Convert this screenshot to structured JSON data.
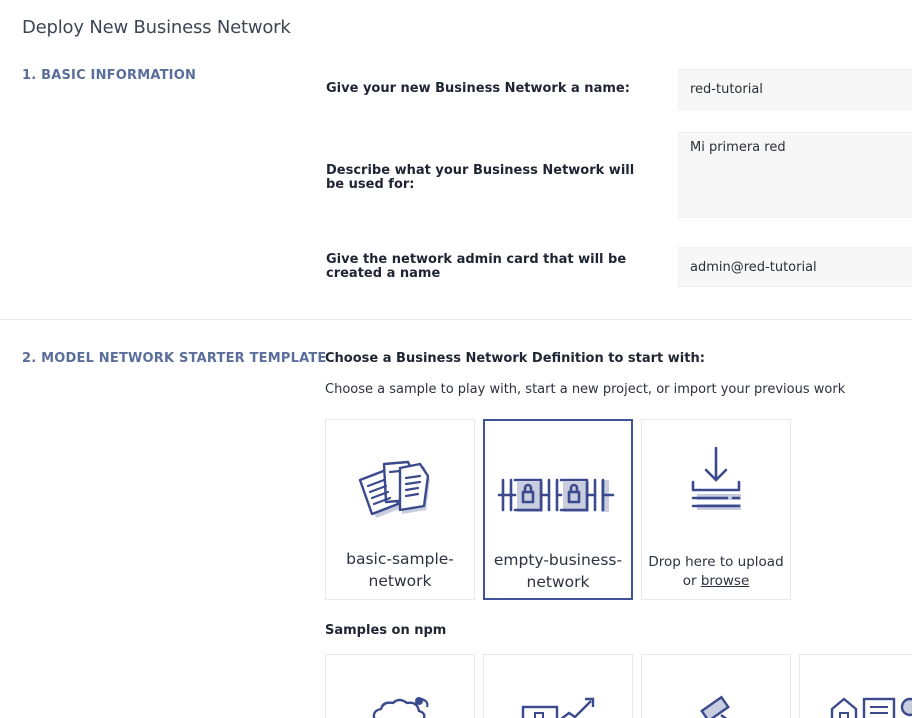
{
  "page": {
    "title": "Deploy New Business Network"
  },
  "basic_info": {
    "heading": "1. BASIC INFORMATION",
    "name_label": "Give your new Business Network a name:",
    "name_value": "red-tutorial",
    "description_label": "Describe what your Business Network will be used for:",
    "description_value": "Mi primera red",
    "card_label": "Give the network admin card that will be created a name",
    "card_value": "admin@red-tutorial"
  },
  "template": {
    "heading": "2. MODEL NETWORK STARTER TEMPLATE",
    "choose_title": "Choose a Business Network Definition to start with:",
    "choose_subtitle": "Choose a sample to play with, start a new project, or import your previous work",
    "tiles": [
      {
        "label": "basic-sample-network",
        "icon": "documents-icon",
        "selected": false
      },
      {
        "label": "empty-business-network",
        "icon": "empty-network-icon",
        "selected": true
      }
    ],
    "drop": {
      "text": "Drop here to upload or",
      "link": "browse",
      "icon": "download-icon"
    },
    "npm_heading": "Samples on npm",
    "npm_tiles": [
      {
        "icon": "animal-icon"
      },
      {
        "icon": "chart-icon"
      },
      {
        "icon": "auction-hammer-icon"
      },
      {
        "icon": "property-icon"
      }
    ]
  },
  "colors": {
    "accent": "#3f5399",
    "heading": "#5a6e9b",
    "icon": "#3b4a8c",
    "icon_shadow": "#c8cde0"
  }
}
